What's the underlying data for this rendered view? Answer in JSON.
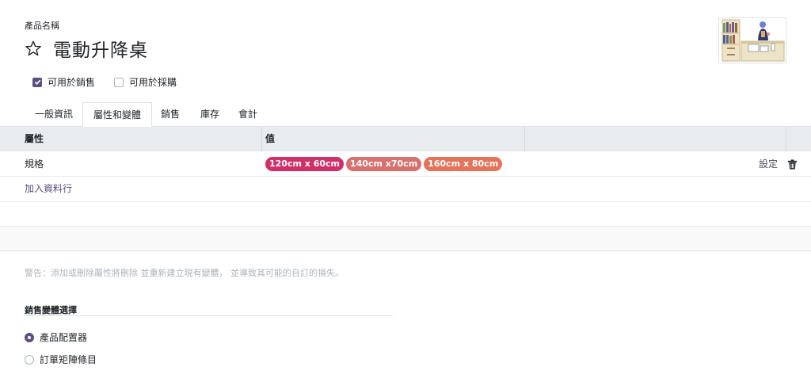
{
  "form": {
    "name_label": "產品名稱",
    "product_name": "電動升降桌",
    "favorite": false,
    "can_be_sold_label": "可用於銷售",
    "can_be_sold": true,
    "can_be_purchased_label": "可用於採購",
    "can_be_purchased": false
  },
  "tabs": [
    {
      "label": "一般資訊",
      "active": false
    },
    {
      "label": "屬性和變體",
      "active": true
    },
    {
      "label": "銷售",
      "active": false
    },
    {
      "label": "庫存",
      "active": false
    },
    {
      "label": "會計",
      "active": false
    }
  ],
  "table": {
    "columns": [
      "屬性",
      "值"
    ],
    "rows": [
      {
        "attribute": "規格",
        "values": [
          {
            "label": "120cm x 60cm",
            "color": "#d0306a"
          },
          {
            "label": "140cm x70cm",
            "color": "#d8716e"
          },
          {
            "label": "160cm x 80cm",
            "color": "#e3735a"
          }
        ],
        "configure_label": "設定",
        "delete_icon": "trash-icon"
      }
    ],
    "add_line_label": "加入資料行"
  },
  "warning": "警告：添加或刪除屬性將刪除 並重新建立現有變體， 並導致其可能的自訂的損失。",
  "variant_selection": {
    "title": "銷售變體選擇",
    "options": [
      {
        "label": "產品配置器",
        "selected": true
      },
      {
        "label": "訂單矩陣條目",
        "selected": false
      }
    ]
  },
  "colors": {
    "primary": "#5e4f82",
    "header_bg": "#e9ecef"
  }
}
